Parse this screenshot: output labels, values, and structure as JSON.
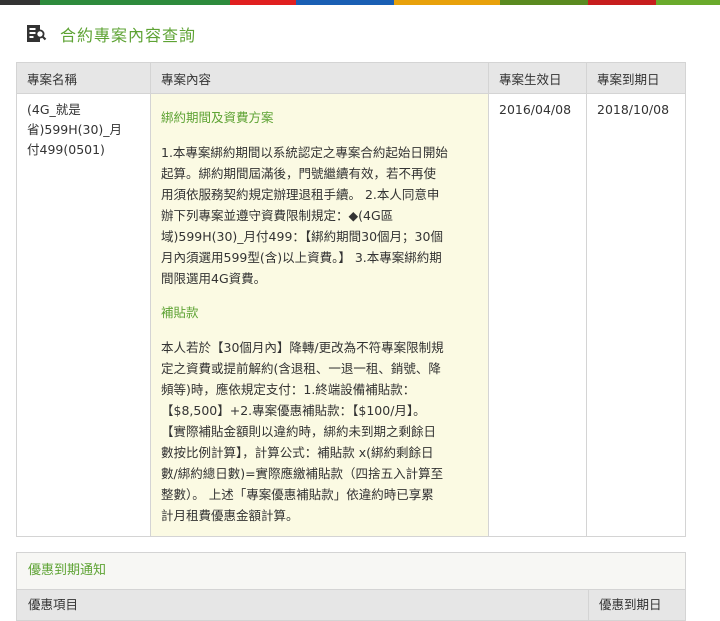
{
  "top_bar_colors": [
    "#333333",
    "#2e8b3c",
    "#e02020",
    "#1a5fb4",
    "#e8a10b",
    "#5a8a20",
    "#c71e1e",
    "#6aaa2c"
  ],
  "page_title": "合約專案內容查詢",
  "table": {
    "headers": {
      "name": "專案名稱",
      "content": "專案內容",
      "start": "專案生效日",
      "end": "專案到期日"
    },
    "row": {
      "name_lines": [
        "(4G_就是",
        "省)599H(30)_月",
        "付499(0501)"
      ],
      "start": "2016/04/08",
      "end": "2018/10/08",
      "section1_title": "綁約期間及資費方案",
      "section1_lines": [
        "1.本專案綁約期間以系統認定之專案合約起始日開始",
        "起算。綁約期間屆滿後，門號繼續有效，若不再使",
        "用須依服務契約規定辦理退租手續。 2.本人同意申",
        "辦下列專案並遵守資費限制規定：◆(4G區",
        "域)599H(30)_月付499：【綁約期間30個月；30個",
        "月內須選用599型(含)以上資費。】 3.本專案綁約期",
        "間限選用4G資費。"
      ],
      "section2_title": "補貼款",
      "section2_lines": [
        "本人若於【30個月內】降轉/更改為不符專案限制規",
        "定之資費或提前解約(含退租、一退一租、銷號、降",
        "頻等)時，應依規定支付：1.終端設備補貼款：",
        "【$8,500】+2.專案優惠補貼款：【$100/月】。",
        "【實際補貼金額則以違約時，綁約未到期之剩餘日",
        "數按比例計算】，計算公式：補貼款 x(綁約剩餘日",
        "數/綁約總日數)=實際應繳補貼款（四捨五入計算至",
        "整數）。 上述「專案優惠補貼款」依違約時已享累",
        "計月租費優惠金額計算。"
      ]
    }
  },
  "notice": {
    "title": "優惠到期通知",
    "col_item": "優惠項目",
    "col_end": "優惠到期日"
  },
  "icons": {
    "title_icon": "document-search-icon"
  },
  "accent_color": "#5ea334"
}
